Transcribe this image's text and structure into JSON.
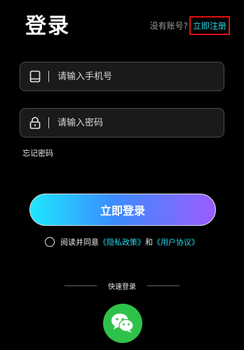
{
  "header": {
    "title": "登录",
    "no_account": "没有账号?",
    "register_link": "立即注册"
  },
  "form": {
    "phone_placeholder": "请输入手机号",
    "password_placeholder": "请输入密码",
    "forgot_password": "忘记密码",
    "login_button": "立即登录"
  },
  "agreement": {
    "prefix": "阅读并同意",
    "privacy_policy": "《隐私政策》",
    "and": "和",
    "user_agreement": "《用户协议》"
  },
  "quick_login": {
    "label": "快速登录",
    "wechat_icon": "wechat-icon"
  },
  "colors": {
    "accent": "#28d3e6",
    "highlight_box": "#e01010",
    "wechat_green": "#2fc24a"
  }
}
